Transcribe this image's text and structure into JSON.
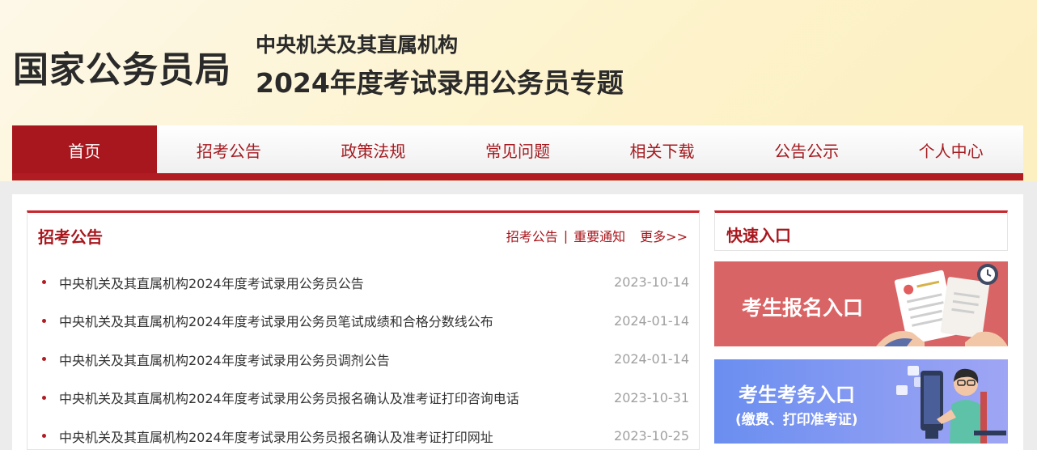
{
  "header": {
    "logo_title": "国家公务员局",
    "subtitle_1": "中央机关及其直属机构",
    "subtitle_2": "2024年度考试录用公务员专题"
  },
  "nav": {
    "items": [
      {
        "label": "首页",
        "active": true
      },
      {
        "label": "招考公告"
      },
      {
        "label": "政策法规"
      },
      {
        "label": "常见问题"
      },
      {
        "label": "相关下载"
      },
      {
        "label": "公告公示"
      },
      {
        "label": "个人中心"
      }
    ]
  },
  "announcements": {
    "title": "招考公告",
    "link_1": "招考公告",
    "separator": "|",
    "link_2": "重要通知",
    "more": "更多>>",
    "items": [
      {
        "title": "中央机关及其直属机构2024年度考试录用公务员公告",
        "date": "2023-10-14"
      },
      {
        "title": "中央机关及其直属机构2024年度考试录用公务员笔试成绩和合格分数线公布",
        "date": "2024-01-14"
      },
      {
        "title": "中央机关及其直属机构2024年度考试录用公务员调剂公告",
        "date": "2024-01-14"
      },
      {
        "title": "中央机关及其直属机构2024年度考试录用公务员报名确认及准考证打印咨询电话",
        "date": "2023-10-31"
      },
      {
        "title": "中央机关及其直属机构2024年度考试录用公务员报名确认及准考证打印网址",
        "date": "2023-10-25"
      }
    ]
  },
  "quick_entry": {
    "title": "快速入口",
    "banner_1": {
      "label": "考生报名入口",
      "color": "#d96465",
      "icon": "document-clock-illustration"
    },
    "banner_2": {
      "label": "考生考务入口",
      "sub": "(缴费、打印准考证)",
      "color": "#6a8ef0",
      "icon": "person-at-computer-illustration"
    }
  },
  "colors": {
    "accent": "#a8171d",
    "header_bg": "#fdf3cc"
  }
}
